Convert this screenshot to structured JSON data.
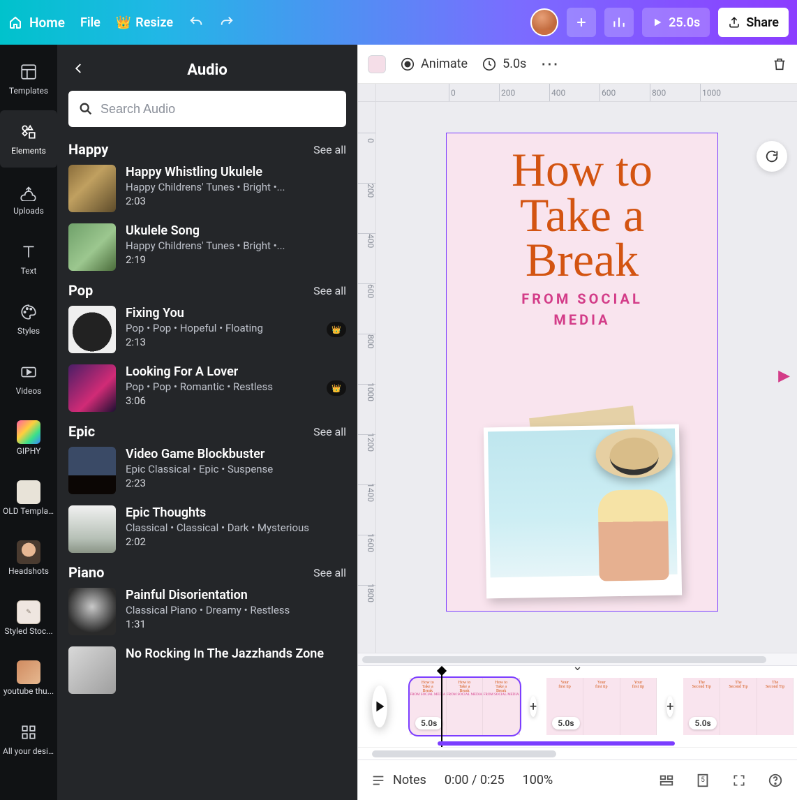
{
  "top": {
    "home": "Home",
    "file": "File",
    "resize": "Resize",
    "play_time": "25.0s",
    "share": "Share"
  },
  "rail": [
    {
      "id": "templates",
      "label": "Templates"
    },
    {
      "id": "elements",
      "label": "Elements"
    },
    {
      "id": "uploads",
      "label": "Uploads"
    },
    {
      "id": "text",
      "label": "Text"
    },
    {
      "id": "styles",
      "label": "Styles"
    },
    {
      "id": "videos",
      "label": "Videos"
    },
    {
      "id": "giphy",
      "label": "GIPHY"
    },
    {
      "id": "old-templates",
      "label": "OLD Templa..."
    },
    {
      "id": "headshots",
      "label": "Headshots"
    },
    {
      "id": "styled-stock",
      "label": "Styled Stoc..."
    },
    {
      "id": "youtube",
      "label": "youtube thu..."
    },
    {
      "id": "all-designs",
      "label": "All your desi..."
    }
  ],
  "panel": {
    "title": "Audio",
    "search_placeholder": "Search Audio",
    "see_all": "See all",
    "sections": [
      {
        "title": "Happy",
        "tracks": [
          {
            "name": "Happy Whistling Ukulele",
            "tags": "Happy Childrens' Tunes • Bright •...",
            "dur": "2:03",
            "thumb": "linear-gradient(135deg,#8a6d3b,#c0a060 40%,#5d4b2a)"
          },
          {
            "name": "Ukulele Song",
            "tags": "Happy Childrens' Tunes • Bright •...",
            "dur": "2:19",
            "thumb": "linear-gradient(135deg,#6fa06a,#9cc78f 55%,#4a6b3a)"
          }
        ]
      },
      {
        "title": "Pop",
        "tracks": [
          {
            "name": "Fixing You",
            "tags": "Pop • Pop • Hopeful • Floating",
            "dur": "2:13",
            "crown": true,
            "thumb": "radial-gradient(circle at 50% 55%,#222 0 28px,#efefef 28px)"
          },
          {
            "name": "Looking For A Lover",
            "tags": "Pop • Pop • Romantic • Restless",
            "dur": "3:06",
            "crown": true,
            "thumb": "linear-gradient(135deg,#4a1e66,#d12b76 60%,#1c0f32)"
          }
        ]
      },
      {
        "title": "Epic",
        "tracks": [
          {
            "name": "Video Game Blockbuster",
            "tags": "Epic Classical • Epic • Suspense",
            "dur": "2:23",
            "thumb": "linear-gradient(180deg,#3a4a66 0 60%,#0b0604 60%)"
          },
          {
            "name": "Epic Thoughts",
            "tags": "Classical • Classical • Dark • Mysterious",
            "dur": "2:02",
            "thumb": "linear-gradient(180deg,#f1f1f1,#b6c0b6 70%,#8a9486)"
          }
        ]
      },
      {
        "title": "Piano",
        "tracks": [
          {
            "name": "Painful Disorientation",
            "tags": "Classical Piano • Dreamy • Restless",
            "dur": "1:31",
            "thumb": "radial-gradient(circle at 50% 40%,#c9c9c9,#2a2a2a 70%)"
          },
          {
            "name": "No Rocking In The Jazzhands Zone",
            "tags": "",
            "dur": "",
            "thumb": "linear-gradient(135deg,#d9d9d9,#9e9e9e)"
          }
        ]
      }
    ]
  },
  "tools": {
    "animate": "Animate",
    "duration": "5.0s"
  },
  "ruler_h": [
    0,
    200,
    400,
    600,
    800,
    1000
  ],
  "ruler_v": [
    0,
    200,
    400,
    600,
    800,
    1000,
    1200,
    1400,
    1600,
    1800
  ],
  "page": {
    "title_lines": [
      "How to",
      "Take a",
      "Break"
    ],
    "subtitle_lines": [
      "FROM SOCIAL",
      "MEDIA"
    ]
  },
  "timeline": {
    "slides": [
      {
        "badge": "5.0s",
        "lines": [
          "How to",
          "Take a",
          "Break"
        ],
        "sub": "FROM SOCIAL MEDIA",
        "selected": true
      },
      {
        "badge": "5.0s",
        "lines": [
          "Your",
          "first tip"
        ],
        "sub": "",
        "selected": false
      },
      {
        "badge": "5.0s",
        "lines": [
          "The",
          "Second Tip"
        ],
        "sub": "",
        "selected": false
      }
    ]
  },
  "bottom": {
    "notes": "Notes",
    "time": "0:00 / 0:25",
    "zoom": "100%",
    "page_badge": "5"
  }
}
